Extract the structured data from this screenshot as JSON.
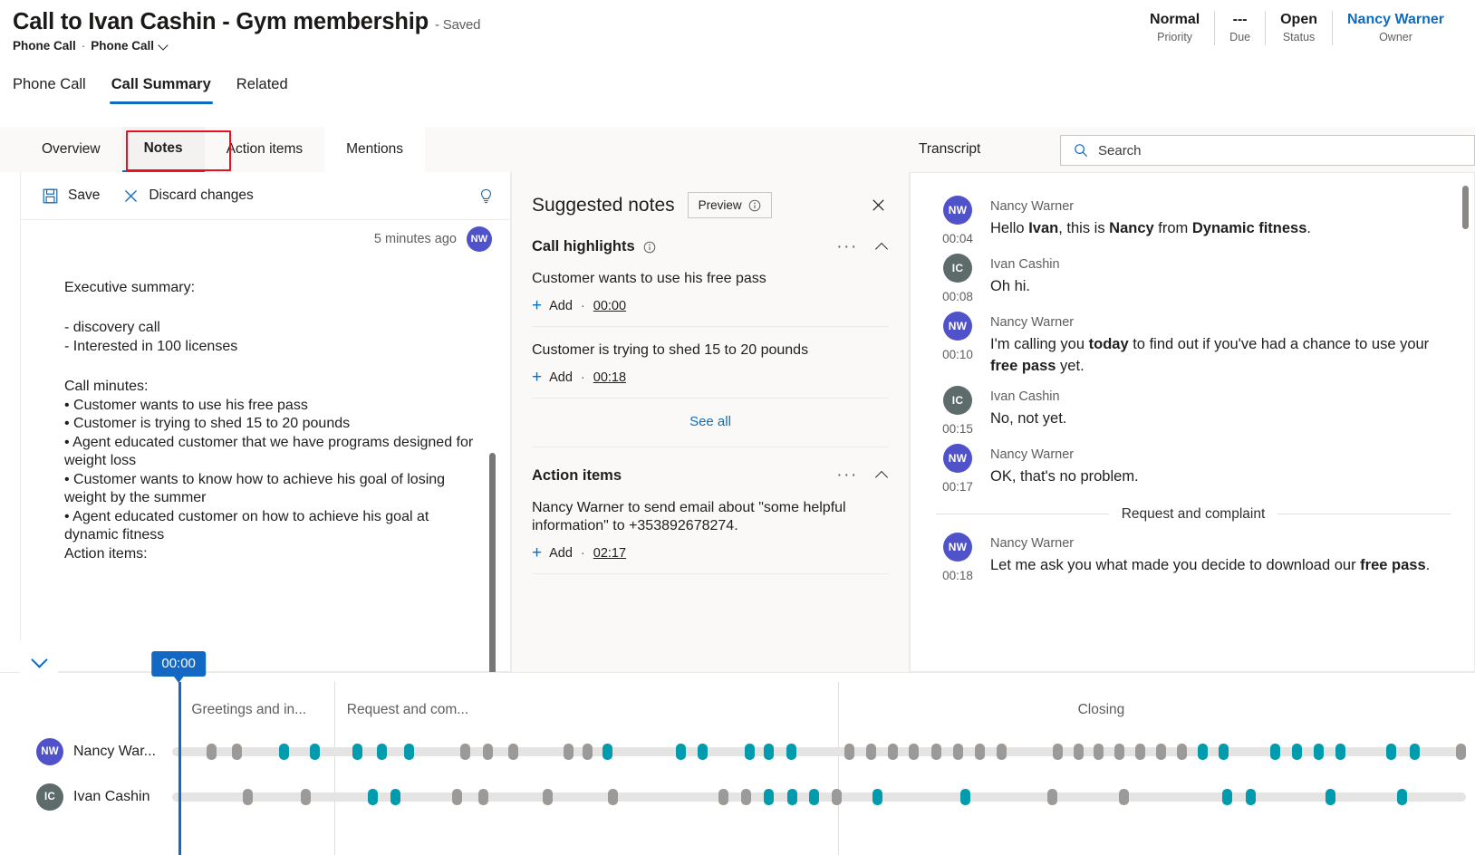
{
  "header": {
    "title": "Call to Ivan Cashin - Gym membership",
    "saved_label": "- Saved",
    "entity_type": "Phone Call",
    "separator": "·",
    "form_name": "Phone Call",
    "stats": [
      {
        "value": "Normal",
        "label": "Priority",
        "is_link": false
      },
      {
        "value": "---",
        "label": "Due",
        "is_link": false
      },
      {
        "value": "Open",
        "label": "Status",
        "is_link": false
      },
      {
        "value": "Nancy Warner",
        "label": "Owner",
        "is_link": true
      }
    ]
  },
  "main_tabs": [
    {
      "label": "Phone Call",
      "active": false
    },
    {
      "label": "Call Summary",
      "active": true
    },
    {
      "label": "Related",
      "active": false
    }
  ],
  "sub_tabs": [
    {
      "label": "Overview",
      "selected": false
    },
    {
      "label": "Notes",
      "selected": true
    },
    {
      "label": "Action items",
      "selected": false
    },
    {
      "label": "Mentions",
      "selected": false
    }
  ],
  "transcript_panel": {
    "label": "Transcript",
    "search_placeholder": "Search",
    "search_value": "",
    "search_icon": "search-icon",
    "entries": [
      {
        "initials": "NW",
        "avatar_kind": "nw",
        "speaker": "Nancy Warner",
        "time": "00:04",
        "parts": [
          {
            "t": "Hello ",
            "b": false
          },
          {
            "t": "Ivan",
            "b": true
          },
          {
            "t": ", this is ",
            "b": false
          },
          {
            "t": "Nancy",
            "b": true
          },
          {
            "t": " from ",
            "b": false
          },
          {
            "t": "Dynamic fitness",
            "b": true
          },
          {
            "t": ".",
            "b": false
          }
        ]
      },
      {
        "initials": "IC",
        "avatar_kind": "ic",
        "speaker": "Ivan Cashin",
        "time": "00:08",
        "parts": [
          {
            "t": "Oh hi.",
            "b": false
          }
        ]
      },
      {
        "initials": "NW",
        "avatar_kind": "nw",
        "speaker": "Nancy Warner",
        "time": "00:10",
        "parts": [
          {
            "t": "I'm calling you ",
            "b": false
          },
          {
            "t": "today",
            "b": true
          },
          {
            "t": " to find out if you've had a chance to use your ",
            "b": false
          },
          {
            "t": "free pass",
            "b": true
          },
          {
            "t": " yet.",
            "b": false
          }
        ]
      },
      {
        "initials": "IC",
        "avatar_kind": "ic",
        "speaker": "Ivan Cashin",
        "time": "00:15",
        "parts": [
          {
            "t": "No, not yet.",
            "b": false
          }
        ]
      },
      {
        "initials": "NW",
        "avatar_kind": "nw",
        "speaker": "Nancy Warner",
        "time": "00:17",
        "parts": [
          {
            "t": "OK, that's no problem.",
            "b": false
          }
        ]
      },
      {
        "separator": "Request and complaint"
      },
      {
        "initials": "NW",
        "avatar_kind": "nw",
        "speaker": "Nancy Warner",
        "time": "00:18",
        "parts": [
          {
            "t": "Let me ask you what made you decide to download our ",
            "b": false
          },
          {
            "t": "free pass",
            "b": true
          },
          {
            "t": ".",
            "b": false
          }
        ]
      }
    ]
  },
  "notes_editor": {
    "save_label": "Save",
    "save_icon": "save-disk-icon",
    "discard_label": "Discard changes",
    "discard_icon": "close-x-icon",
    "insight_icon": "lightbulb-icon",
    "timestamp": "5 minutes ago",
    "author_initials": "NW",
    "content_lines": [
      {
        "text": "Executive summary:",
        "style": "line"
      },
      {
        "text": "",
        "style": "gap"
      },
      {
        "text": "- discovery call",
        "style": "line"
      },
      {
        "text": "- Interested in 100 licenses",
        "style": "line"
      },
      {
        "text": "",
        "style": "gap"
      },
      {
        "text": "Call minutes:",
        "style": "line"
      },
      {
        "text": "• Customer wants to use his free pass",
        "style": "line"
      },
      {
        "text": "• Customer is trying to shed 15 to 20 pounds",
        "style": "bullet"
      },
      {
        "text": "• Agent educated customer that we have programs designed for weight loss",
        "style": "bullet"
      },
      {
        "text": "• Customer wants to know how to achieve his goal of losing weight by the summer",
        "style": "bullet"
      },
      {
        "text": "• Agent educated customer on how to achieve his goal at dynamic fitness",
        "style": "bullet"
      },
      {
        "text": "Action items:",
        "style": "bullet"
      }
    ]
  },
  "suggested_notes": {
    "title": "Suggested notes",
    "preview_label": "Preview",
    "preview_info_icon": "info-icon",
    "close_icon": "close-x-icon",
    "see_all_label": "See all",
    "sections": [
      {
        "title": "Call highlights",
        "has_info_icon": true,
        "more_icon": "more-options-icon",
        "collapse_icon": "chevron-up-icon",
        "items": [
          {
            "text": "Customer wants to use his free pass",
            "add_label": "Add",
            "timestamp": "00:00"
          },
          {
            "text": "Customer is trying to shed 15 to 20 pounds",
            "add_label": "Add",
            "timestamp": "00:18"
          }
        ]
      },
      {
        "title": "Action items",
        "has_info_icon": false,
        "more_icon": "more-options-icon",
        "collapse_icon": "chevron-up-icon",
        "items": [
          {
            "text": "Nancy Warner to send email about \"some helpful information\" to +353892678274.",
            "add_label": "Add",
            "timestamp": "02:17"
          }
        ]
      }
    ]
  },
  "timeline": {
    "collapse_icon": "chevron-down-icon",
    "playhead_label": "00:00",
    "playhead_pct": 0.5,
    "segments": [
      {
        "label": "Greetings and in...",
        "start_pct": 0.5,
        "label_pct": 1.5
      },
      {
        "label": "Request and com...",
        "start_pct": 12.5,
        "label_pct": 13.5
      },
      {
        "label": "Closing",
        "start_pct": 51.5,
        "label_pct": 70.0
      }
    ],
    "speakers": [
      {
        "name": "Nancy War...",
        "initials": "NW",
        "avatar_kind": "nw",
        "ticks": [
          {
            "p": 3.0,
            "c": "g"
          },
          {
            "p": 5.0,
            "c": "g"
          },
          {
            "p": 8.6,
            "c": "c"
          },
          {
            "p": 11.0,
            "c": "c"
          },
          {
            "p": 14.3,
            "c": "c"
          },
          {
            "p": 16.2,
            "c": "c"
          },
          {
            "p": 18.3,
            "c": "c"
          },
          {
            "p": 22.6,
            "c": "g"
          },
          {
            "p": 24.4,
            "c": "g"
          },
          {
            "p": 26.3,
            "c": "g"
          },
          {
            "p": 30.6,
            "c": "g"
          },
          {
            "p": 32.1,
            "c": "g"
          },
          {
            "p": 33.6,
            "c": "c"
          },
          {
            "p": 39.3,
            "c": "c"
          },
          {
            "p": 41.0,
            "c": "c"
          },
          {
            "p": 44.6,
            "c": "c"
          },
          {
            "p": 46.1,
            "c": "c"
          },
          {
            "p": 47.8,
            "c": "c"
          },
          {
            "p": 52.3,
            "c": "g"
          },
          {
            "p": 54.0,
            "c": "g"
          },
          {
            "p": 55.7,
            "c": "g"
          },
          {
            "p": 57.3,
            "c": "g"
          },
          {
            "p": 59.0,
            "c": "g"
          },
          {
            "p": 60.7,
            "c": "g"
          },
          {
            "p": 62.4,
            "c": "g"
          },
          {
            "p": 64.1,
            "c": "g"
          },
          {
            "p": 68.4,
            "c": "g"
          },
          {
            "p": 70.0,
            "c": "g"
          },
          {
            "p": 71.6,
            "c": "g"
          },
          {
            "p": 73.2,
            "c": "g"
          },
          {
            "p": 74.8,
            "c": "g"
          },
          {
            "p": 76.4,
            "c": "g"
          },
          {
            "p": 78.0,
            "c": "g"
          },
          {
            "p": 79.6,
            "c": "c"
          },
          {
            "p": 81.2,
            "c": "c"
          },
          {
            "p": 85.2,
            "c": "c"
          },
          {
            "p": 86.9,
            "c": "c"
          },
          {
            "p": 88.6,
            "c": "c"
          },
          {
            "p": 90.3,
            "c": "c"
          },
          {
            "p": 94.2,
            "c": "c"
          },
          {
            "p": 96.0,
            "c": "c"
          },
          {
            "p": 99.6,
            "c": "g"
          }
        ]
      },
      {
        "name": "Ivan Cashin",
        "initials": "IC",
        "avatar_kind": "ic",
        "ticks": [
          {
            "p": 5.8,
            "c": "g"
          },
          {
            "p": 10.3,
            "c": "g"
          },
          {
            "p": 15.5,
            "c": "c"
          },
          {
            "p": 17.2,
            "c": "c"
          },
          {
            "p": 22.0,
            "c": "g"
          },
          {
            "p": 24.0,
            "c": "g"
          },
          {
            "p": 29.0,
            "c": "g"
          },
          {
            "p": 34.0,
            "c": "g"
          },
          {
            "p": 42.6,
            "c": "g"
          },
          {
            "p": 44.3,
            "c": "g"
          },
          {
            "p": 46.1,
            "c": "c"
          },
          {
            "p": 47.9,
            "c": "c"
          },
          {
            "p": 49.6,
            "c": "c"
          },
          {
            "p": 51.3,
            "c": "g"
          },
          {
            "p": 54.5,
            "c": "c"
          },
          {
            "p": 61.3,
            "c": "c"
          },
          {
            "p": 68.0,
            "c": "g"
          },
          {
            "p": 73.5,
            "c": "g"
          },
          {
            "p": 81.5,
            "c": "c"
          },
          {
            "p": 83.3,
            "c": "c"
          },
          {
            "p": 89.5,
            "c": "c"
          },
          {
            "p": 95.0,
            "c": "c"
          }
        ]
      }
    ]
  },
  "colors": {
    "accent_blue": "#0f6cbd",
    "playhead_blue": "#1268c3",
    "highlight_red": "#e81123",
    "avatar_nw": "#4f52c9",
    "avatar_ic": "#5d6b6b",
    "tick_grey": "#9b9a99",
    "tick_teal": "#009cad"
  }
}
